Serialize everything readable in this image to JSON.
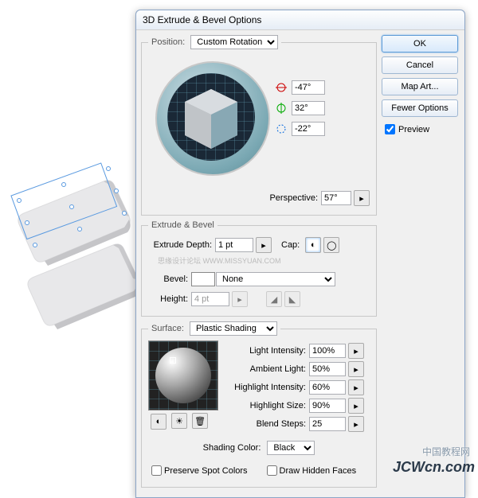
{
  "dialog": {
    "title": "3D Extrude & Bevel Options",
    "buttons": {
      "ok": "OK",
      "cancel": "Cancel",
      "map_art": "Map Art...",
      "fewer_options": "Fewer Options"
    },
    "preview_label": "Preview",
    "preview_checked": true
  },
  "position": {
    "legend": "Position:",
    "rotation_mode": "Custom Rotation",
    "angle_x": "-47°",
    "angle_y": "32°",
    "angle_z": "-22°",
    "perspective_label": "Perspective:",
    "perspective": "57°"
  },
  "extrude": {
    "legend": "Extrude & Bevel",
    "depth_label": "Extrude Depth:",
    "depth": "1 pt",
    "cap_label": "Cap:",
    "bevel_label": "Bevel:",
    "bevel": "None",
    "height_label": "Height:",
    "height": "4 pt",
    "watermark": "思缘设计论坛  WWW.MISSYUAN.COM"
  },
  "surface": {
    "legend": "Surface:",
    "shading": "Plastic Shading",
    "light_intensity_label": "Light Intensity:",
    "light_intensity": "100%",
    "ambient_light_label": "Ambient Light:",
    "ambient_light": "50%",
    "highlight_intensity_label": "Highlight Intensity:",
    "highlight_intensity": "60%",
    "highlight_size_label": "Highlight Size:",
    "highlight_size": "90%",
    "blend_steps_label": "Blend Steps:",
    "blend_steps": "25",
    "shading_color_label": "Shading Color:",
    "shading_color": "Black"
  },
  "footer": {
    "preserve_spot": "Preserve Spot Colors",
    "draw_hidden": "Draw Hidden Faces"
  },
  "watermark_cn": "中国教程网",
  "watermark_en": "JCWcn.com"
}
